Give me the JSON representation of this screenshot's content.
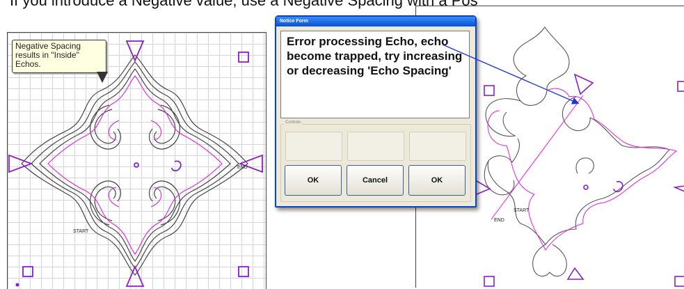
{
  "caption": "If you introduce a Negative value, use a Negative Spacing with a Pos",
  "left_panel": {
    "callout": "Negative Spacing results in \"Inside\" Echos.",
    "start_label": "START",
    "end_label": "END"
  },
  "dialog": {
    "title": "Notice Form",
    "message": "Error processing Echo, echo become trapped, try increasing or decreasing 'Echo Spacing'",
    "controls_label": "Controls",
    "buttons": {
      "ok_left": "OK",
      "cancel": "Cancel",
      "ok_right": "OK"
    }
  },
  "right_panel": {
    "start_label": "START",
    "end_label": "END"
  },
  "colors": {
    "echo_outline": "#444444",
    "magenta_path": "#e41ce4",
    "marker": "#8b1fc7",
    "arrow": "#1a35d6",
    "titlebar": "#0a4fd6"
  }
}
